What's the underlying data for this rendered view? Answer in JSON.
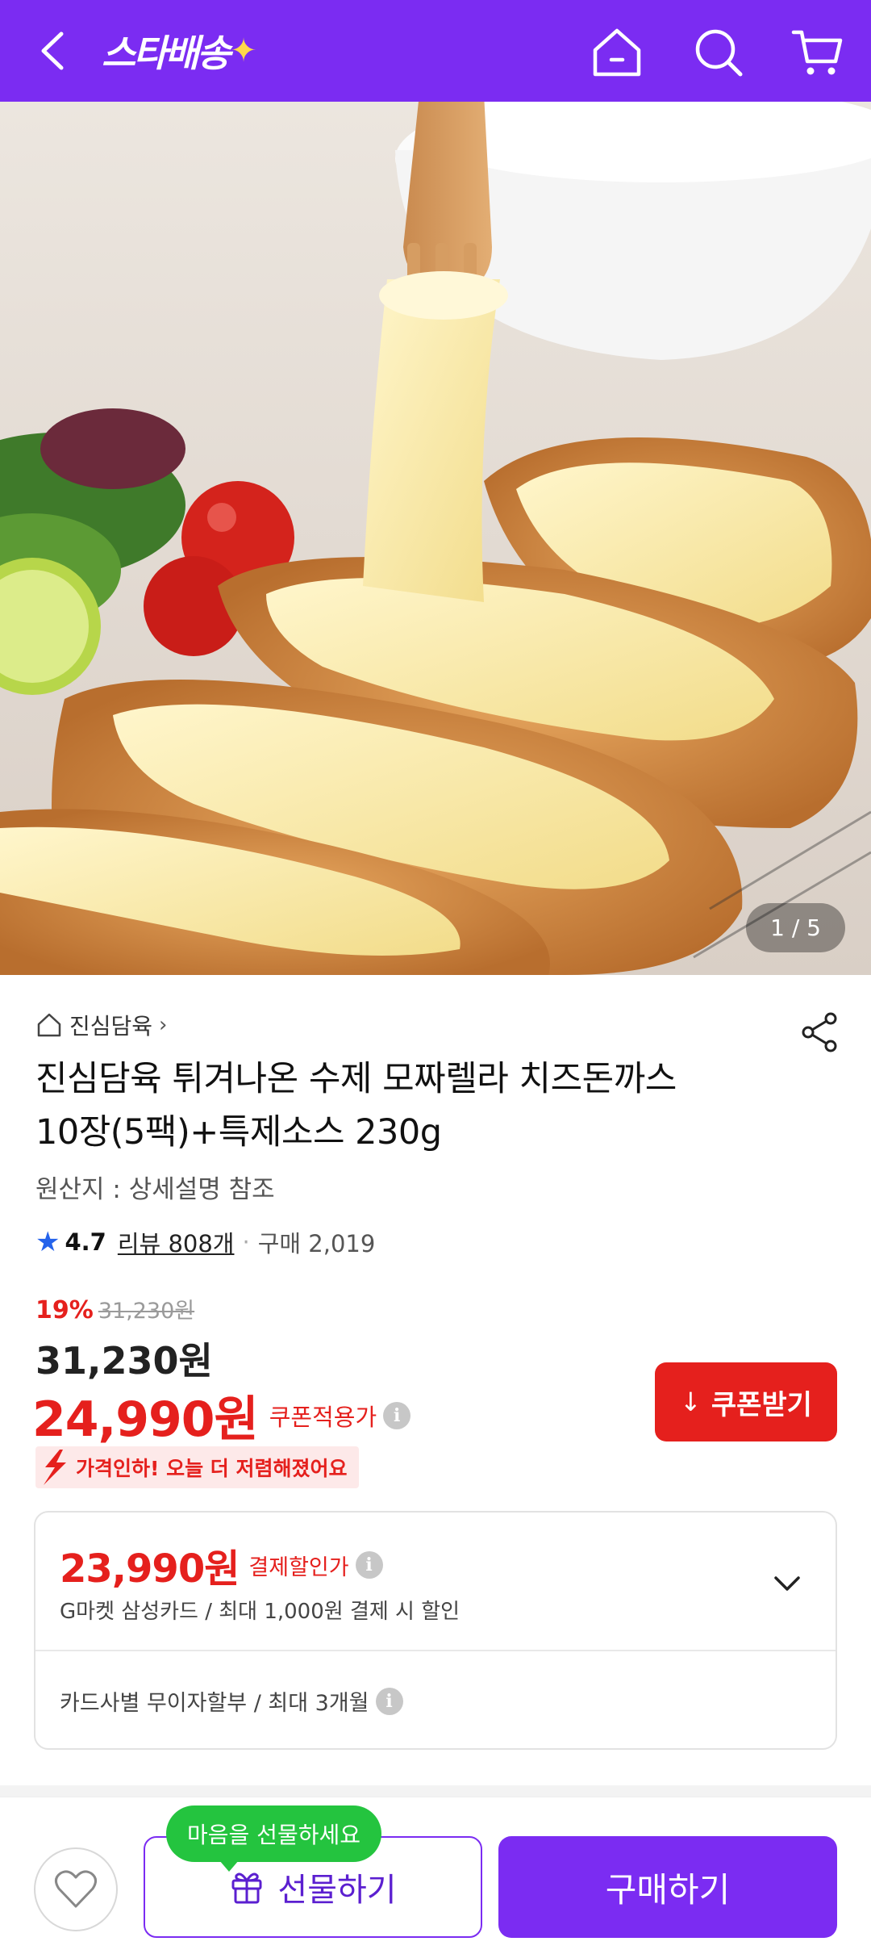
{
  "header": {
    "logo_text": "스타배송",
    "logo_star": "✦",
    "icons": [
      "back-icon",
      "home-icon",
      "search-icon",
      "cart-icon"
    ]
  },
  "gallery": {
    "counter": "1 / 5"
  },
  "product": {
    "brand": "진심담육",
    "brand_chevron": "›",
    "title_line1": "진심담육 튀겨나온 수제 모짜렐라 치즈돈까스",
    "title_line2": "10장(5팩)+특제소스 230g",
    "origin": "원산지 : 상세설명 참조",
    "rating": "4.7",
    "reviews": "리뷰 808개",
    "dot": "·",
    "purchases": "구매 2,019"
  },
  "price": {
    "discount_pct": "19%",
    "original": "31,230원",
    "sale": "31,230원",
    "coupon_price": "24,990원",
    "coupon_label": "쿠폰적용가",
    "coupon_button": "쿠폰받기",
    "promo": "가격인하! 오늘 더 저렴해졌어요"
  },
  "card": {
    "price": "23,990원",
    "label": "결제할인가",
    "desc": "G마켓 삼성카드 / 최대 1,000원 결제 시 할인",
    "installment": "카드사별 무이자할부 / 최대 3개월"
  },
  "bottom": {
    "tooltip": "마음을 선물하세요",
    "gift": "선물하기",
    "buy": "구매하기"
  },
  "colors": {
    "brand_purple": "#7b2cf2",
    "price_red": "#e5201d",
    "tooltip_green": "#24c43f",
    "rating_star": "#2563eb"
  }
}
